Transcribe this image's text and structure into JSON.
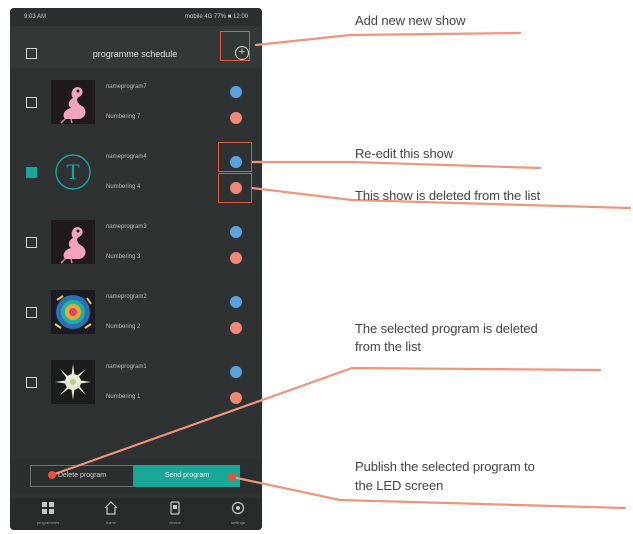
{
  "phone": {
    "status": {
      "left": "9:03 AM",
      "right": "mobile 4G 77% ■ 12:00"
    },
    "header": {
      "title": "programme schedule",
      "add_icon": "plus-circle-icon"
    },
    "programs": [
      {
        "name": "nameprogram7",
        "number": "Numbering 7",
        "thumb": "flamingo",
        "checked": false
      },
      {
        "name": "nameprogram4",
        "number": "Numbering 4",
        "thumb": "letter-t",
        "letter": "T",
        "checked": true
      },
      {
        "name": "nameprogram3",
        "number": "Numbering 3",
        "thumb": "flamingo",
        "checked": false
      },
      {
        "name": "nameprogram2",
        "number": "Numbering 2",
        "thumb": "swirl",
        "checked": false
      },
      {
        "name": "nameprogram1",
        "number": "Numbering 1",
        "thumb": "sparkle",
        "checked": false
      }
    ],
    "actions": {
      "delete_label": "Delete program",
      "send_label": "Send program"
    },
    "tabs": [
      {
        "label": "programmes",
        "icon": "grid-icon"
      },
      {
        "label": "home",
        "icon": "home-icon"
      },
      {
        "label": "device",
        "icon": "device-icon"
      },
      {
        "label": "settings",
        "icon": "settings-icon"
      }
    ]
  },
  "annotations": {
    "add": "Add new new show",
    "edit": "Re-edit this show",
    "delete": "This show is deleted from the list",
    "delete_selected_1": "The selected program is deleted",
    "delete_selected_2": "from the list",
    "publish_1": "Publish the selected program to",
    "publish_2": "the LED screen"
  },
  "colors": {
    "accent": "#1aa69c",
    "callout": "#f0957c",
    "edit": "#5aa5df",
    "delete": "#f08a75"
  }
}
